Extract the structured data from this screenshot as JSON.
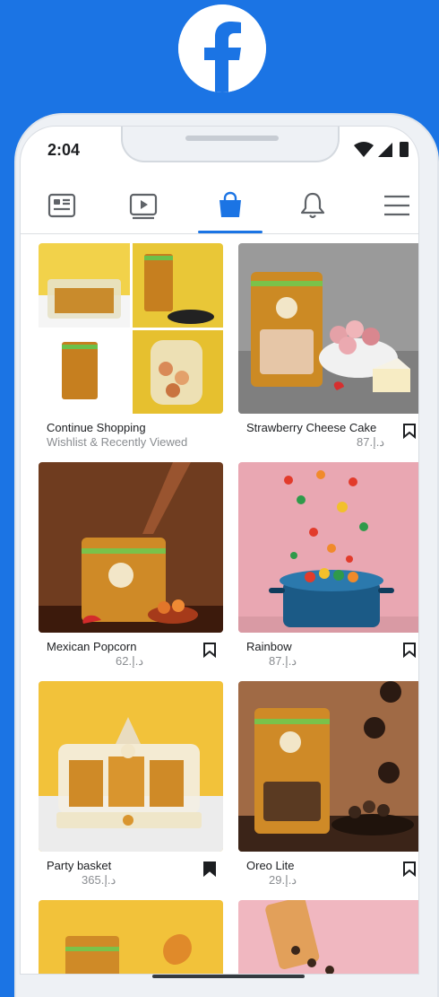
{
  "status_bar": {
    "time": "2:04"
  },
  "icons": {
    "logo": "facebook-logo-icon",
    "tabs": [
      "feed-icon",
      "watch-icon",
      "marketplace-bag-icon",
      "notifications-bell-icon",
      "menu-icon"
    ],
    "bookmark": "bookmark-icon"
  },
  "colors": {
    "brand": "#1b74e4",
    "active_tab": "#1b74e4",
    "text": "#1c1e21",
    "muted": "#8a8d91"
  },
  "active_tab": "marketplace",
  "cards": [
    {
      "title": "Continue Shopping",
      "subtitle": "Wishlist & Recently Viewed"
    },
    {
      "title": "Strawberry Cheese Cake",
      "price": "87.ﺩ.ﺇ",
      "saved": false
    },
    {
      "title": "Mexican Popcorn",
      "price": "62.ﺩ.ﺇ",
      "saved": false
    },
    {
      "title": "Rainbow",
      "price": "87.ﺩ.ﺇ",
      "saved": false
    },
    {
      "title": "Party basket",
      "price": "365.ﺩ.ﺇ",
      "saved": true
    },
    {
      "title": "Oreo Lite",
      "price": "29.ﺩ.ﺇ",
      "saved": false
    }
  ]
}
